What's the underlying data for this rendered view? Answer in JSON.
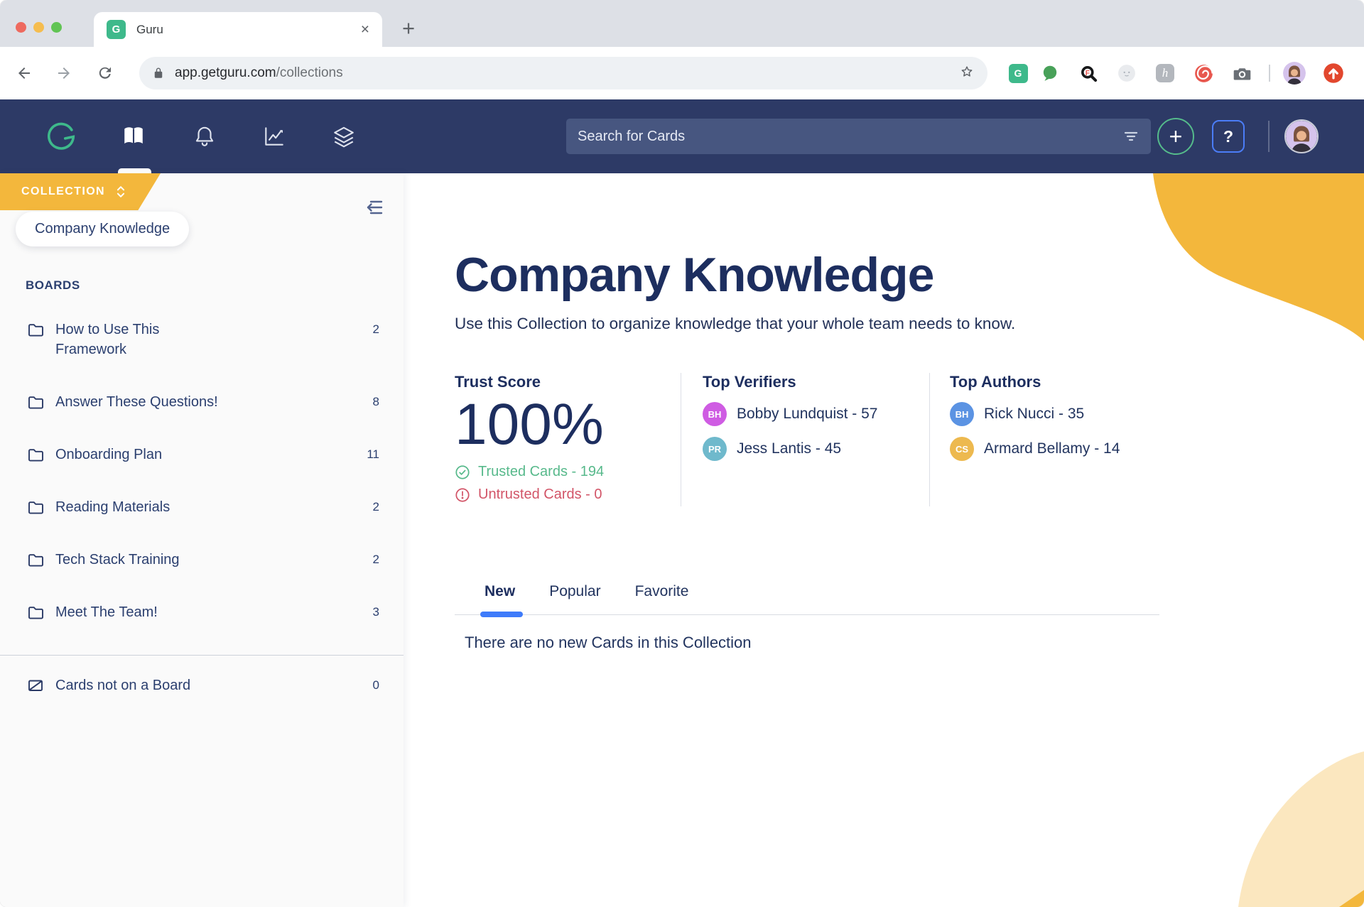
{
  "browser": {
    "tab_title": "Guru",
    "favicon_letter": "G",
    "url_host": "app.getguru.com",
    "url_path": "/collections"
  },
  "icons": {
    "close": "×",
    "new_tab": "+",
    "plus": "+",
    "honey_letter": "h",
    "magnifier_letter": "F"
  },
  "navbar": {
    "search_placeholder": "Search for Cards",
    "help_label": "?"
  },
  "sidebar": {
    "collection_label": "COLLECTION",
    "collection_name": "Company Knowledge",
    "boards_label": "BOARDS",
    "boards": [
      {
        "label": "How to Use This Framework",
        "count": "2"
      },
      {
        "label": "Answer These Questions!",
        "count": "8"
      },
      {
        "label": "Onboarding Plan",
        "count": "11"
      },
      {
        "label": "Reading Materials",
        "count": "2"
      },
      {
        "label": "Tech Stack Training",
        "count": "2"
      },
      {
        "label": "Meet The Team!",
        "count": "3"
      }
    ],
    "unboarded": {
      "label": "Cards not on a Board",
      "count": "0"
    }
  },
  "main": {
    "title": "Company Knowledge",
    "subtitle": "Use this Collection to organize knowledge that your whole team needs to know.",
    "trust": {
      "heading": "Trust Score",
      "score": "100%",
      "trusted_label": "Trusted Cards - 194",
      "untrusted_label": "Untrusted Cards - 0"
    },
    "verifiers": {
      "heading": "Top Verifiers",
      "people": [
        {
          "initials": "BH",
          "color": "#cf5ce3",
          "label": "Bobby Lundquist - 57"
        },
        {
          "initials": "PR",
          "color": "#6fb9cc",
          "label": "Jess Lantis  - 45"
        }
      ]
    },
    "authors": {
      "heading": "Top Authors",
      "people": [
        {
          "initials": "BH",
          "color": "#5b93e3",
          "label": "Rick Nucci - 35"
        },
        {
          "initials": "CS",
          "color": "#edb94f",
          "label": "Armard Bellamy - 14"
        }
      ]
    },
    "tabs": [
      {
        "label": "New",
        "active": true
      },
      {
        "label": "Popular",
        "active": false
      },
      {
        "label": "Favorite",
        "active": false
      }
    ],
    "empty_message": "There are no new Cards in this Collection"
  },
  "colors": {
    "brand_green": "#3eb98b",
    "navbar_navy": "#2d3a66",
    "accent_yellow": "#f3b73c",
    "trusted_green": "#57b98b",
    "untrusted_red": "#d25568",
    "active_tab_blue": "#3e7bfa"
  }
}
